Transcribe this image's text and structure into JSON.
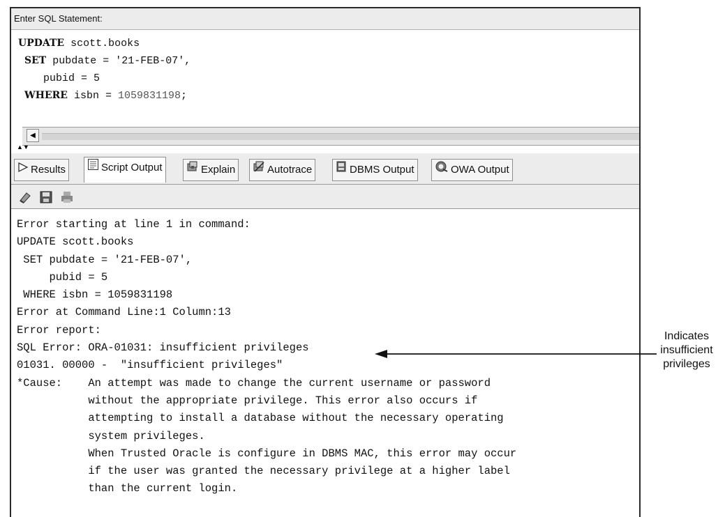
{
  "sql_panel": {
    "label": "Enter SQL Statement:",
    "statement": {
      "update_kw": "UPDATE",
      "table": " scott.books",
      "set_kw": "SET",
      "set_rest": " pubdate = '21-FEB-07',",
      "pubid_line": "    pubid = 5",
      "where_kw": "WHERE",
      "where_rest": " isbn = ",
      "isbn": "1059831198",
      "terminator": ";"
    }
  },
  "tabs": [
    {
      "label": "Results",
      "icon": "play-icon"
    },
    {
      "label": "Script Output",
      "icon": "script-output-icon"
    },
    {
      "label": "Explain",
      "icon": "explain-icon"
    },
    {
      "label": "Autotrace",
      "icon": "autotrace-icon"
    },
    {
      "label": "DBMS Output",
      "icon": "dbms-output-icon"
    },
    {
      "label": "OWA Output",
      "icon": "owa-output-icon"
    }
  ],
  "active_tab": "Script Output",
  "toolbar_icons": [
    "eraser-icon",
    "save-icon",
    "print-icon"
  ],
  "output_lines": [
    "Error starting at line 1 in command:",
    "UPDATE scott.books",
    " SET pubdate = '21-FEB-07',",
    "     pubid = 5",
    " WHERE isbn = 1059831198",
    "Error at Command Line:1 Column:13",
    "Error report:",
    "SQL Error: ORA-01031: insufficient privileges",
    "01031. 00000 -  \"insufficient privileges\"",
    "*Cause:    An attempt was made to change the current username or password",
    "           without the appropriate privilege. This error also occurs if",
    "           attempting to install a database without the necessary operating",
    "           system privileges.",
    "           When Trusted Oracle is configure in DBMS MAC, this error may occur",
    "           if the user was granted the necessary privilege at a higher label",
    "           than the current login."
  ],
  "annotation": {
    "lines": [
      "Indicates",
      "insufficient",
      "privileges"
    ]
  },
  "colors": {
    "panel_bg": "#ececec",
    "border": "#2a2a2a"
  }
}
